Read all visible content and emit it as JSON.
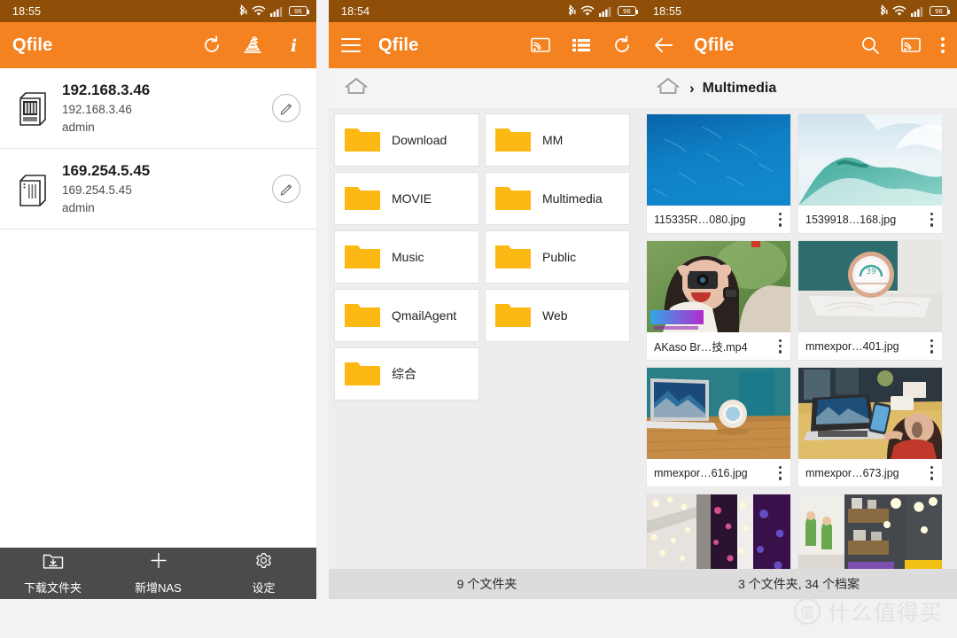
{
  "colors": {
    "accent": "#f58220",
    "statusbar": "#8f4f08",
    "bottombar": "#4b4b4b",
    "folder": "#fcb813",
    "page_bg": "#f2f2f2",
    "countbar": "#dcdcdc"
  },
  "panel1": {
    "status": {
      "clock": "18:55",
      "battery": "96",
      "icons": [
        "bluetooth-icon",
        "wifi-icon",
        "signal-icon",
        "battery-icon"
      ]
    },
    "appbar": {
      "title": "Qfile",
      "actions": [
        {
          "name": "refresh-icon",
          "label": "refresh"
        },
        {
          "name": "transfer-log-icon",
          "label": "transfer status"
        },
        {
          "name": "info-icon",
          "label": "info"
        }
      ]
    },
    "nas_list": [
      {
        "title": "192.168.3.46",
        "host": "192.168.3.46",
        "user": "admin",
        "icon": "nas-tower-icon"
      },
      {
        "title": "169.254.5.45",
        "host": "169.254.5.45",
        "user": "admin",
        "icon": "nas-tower-icon"
      }
    ],
    "bottom_bar": [
      {
        "label": "下载文件夹",
        "icon": "download-folder-icon"
      },
      {
        "label": "新增NAS",
        "icon": "plus-icon"
      },
      {
        "label": "设定",
        "icon": "gear-icon"
      }
    ]
  },
  "panel2": {
    "status": {
      "clock": "18:54",
      "battery": "96"
    },
    "appbar": {
      "title": "Qfile",
      "menu_icon": "hamburger-icon",
      "actions": [
        {
          "name": "cast-icon",
          "label": "cast"
        },
        {
          "name": "list-view-icon",
          "label": "list view"
        },
        {
          "name": "refresh-icon",
          "label": "refresh"
        }
      ]
    },
    "breadcrumb": {
      "home_icon": "home-icon",
      "path": ""
    },
    "folders": [
      "Download",
      "MM",
      "MOVIE",
      "Multimedia",
      "Music",
      "Public",
      "QmailAgent",
      "Web",
      "综合"
    ],
    "count_text": "9 个文件夹"
  },
  "panel3": {
    "status": {
      "clock": "18:55",
      "battery": "96"
    },
    "appbar": {
      "title": "Qfile",
      "back_icon": "back-arrow-icon",
      "actions": [
        {
          "name": "search-icon",
          "label": "search"
        },
        {
          "name": "cast-icon",
          "label": "cast"
        },
        {
          "name": "overflow-menu-icon",
          "label": "more options"
        }
      ]
    },
    "breadcrumb": {
      "home_icon": "home-icon",
      "separator": "›",
      "path": "Multimedia"
    },
    "files": [
      {
        "name": "115335R…080.jpg",
        "thumb": "ocean-blue"
      },
      {
        "name": "1539918…168.jpg",
        "thumb": "wave-white"
      },
      {
        "name": "AKaso Br…技.mp4",
        "thumb": "woman-camera"
      },
      {
        "name": "mmexpor…401.jpg",
        "thumb": "round-speaker"
      },
      {
        "name": "mmexpor…616.jpg",
        "thumb": "laptop-desk"
      },
      {
        "name": "mmexpor…673.jpg",
        "thumb": "laptop-woman"
      },
      {
        "name": "",
        "thumb": "store-lights"
      },
      {
        "name": "",
        "thumb": "shop-shelf"
      }
    ],
    "count_text": "3 个文件夹, 34 个档案"
  },
  "watermark": {
    "logo": "值",
    "text": "什么值得买"
  }
}
